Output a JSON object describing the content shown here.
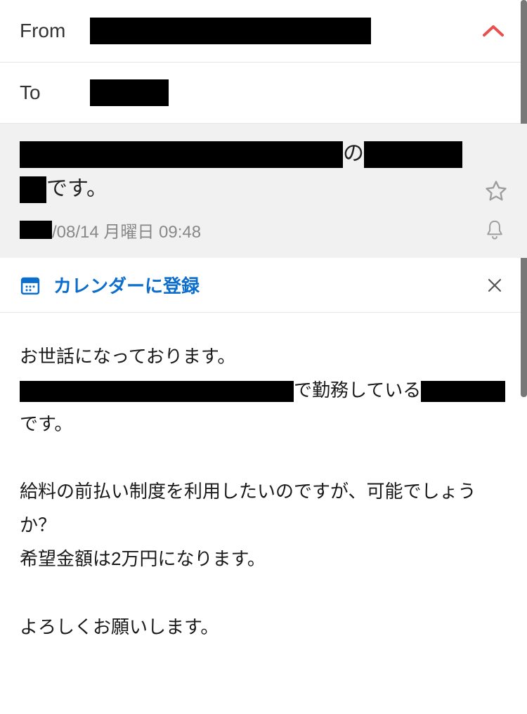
{
  "header": {
    "from_label": "From",
    "to_label": "To"
  },
  "subject": {
    "particle": "の",
    "suffix": "です。"
  },
  "date": {
    "text": "/08/14 月曜日 09:48"
  },
  "calendar": {
    "label": "カレンダーに登録"
  },
  "body": {
    "greeting": "お世話になっております。",
    "line1_mid": "で勤務している",
    "line1_end": "です。",
    "para2_line1": "給料の前払い制度を利用したいのですが、可能でしょうか？",
    "para2_line2": "希望金額は2万円になります。",
    "closing": "よろしくお願いします。"
  },
  "colors": {
    "accent": "#0b6dcc",
    "collapse": "#e85050"
  }
}
